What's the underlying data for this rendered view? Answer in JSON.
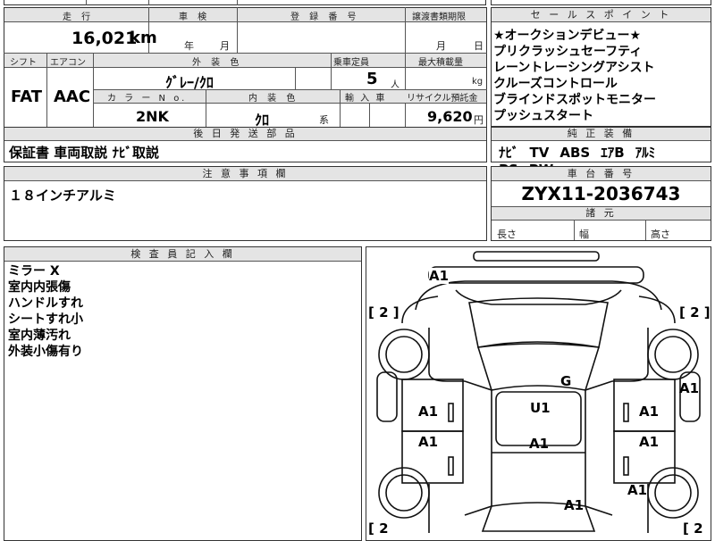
{
  "header": {
    "mileage_label": "走 行",
    "inspection_label": "車 検",
    "registration_label": "登 録 番 号",
    "transfer_deadline_label": "譲渡書類期限",
    "sales_points_label": "セ ー ル ス ポ イ ン ト",
    "shift_label": "シフト",
    "aircon_label": "エアコン",
    "exterior_color_label": "外 装 色",
    "capacity_label": "乗車定員",
    "max_load_label": "最大積載量",
    "color_no_label": "カ ラ ー N o.",
    "interior_color_label": "内 装 色",
    "import_label": "輸 入 車",
    "recycle_label": "リサイクル預託金",
    "parts_label": "後 日 発 送 部 品",
    "standard_equipment_label": "純 正 装 備",
    "notes_label": "注 意 事 項 欄",
    "chassis_label": "車 台 番 号",
    "dimensions_label": "諸 元",
    "inspector_label": "検 査 員 記 入 欄"
  },
  "vehicle": {
    "mileage": "16,021",
    "mileage_unit": "km",
    "inspection_year_unit": "年",
    "inspection_month_unit": "月",
    "deadline_month_unit": "月",
    "deadline_day_unit": "日",
    "shift": "FAT",
    "aircon": "AAC",
    "exterior_color": "ｸﾞﾚｰ/ｸﾛ",
    "capacity": "5",
    "capacity_unit": "人",
    "load_unit": "kg",
    "color_no": "2NK",
    "interior_color": "ｸﾛ",
    "interior_suffix": "系",
    "recycle_fee": "9,620",
    "recycle_unit": "円",
    "chassis_no": "ZYX11-2036743",
    "length_label": "長さ",
    "width_label": "幅",
    "height_label": "高さ"
  },
  "sales_points": [
    "★オークションデビュー★",
    "プリクラッシュセーフティ",
    "レーントレーシングアシスト",
    "クルーズコントロール",
    "ブラインドスポットモニター",
    "プッシュスタート"
  ],
  "equipment": [
    "ﾅﾋﾞ",
    "TV",
    "ABS",
    "ｴｱB",
    "ｱﾙﾐ",
    "PS",
    "PW"
  ],
  "parts_text": "保証書 車両取説 ﾅﾋﾞ取説",
  "notes_text": "１８インチアルミ",
  "inspector_notes": [
    "ミラー X",
    "室内内張傷",
    "ハンドルすれ",
    "シートすれ小",
    "室内薄汚れ",
    "外装小傷有り"
  ],
  "diagram": {
    "tire_marks": [
      "[ 2 ]",
      "[ 2 ]",
      "[ 2",
      "[ 2"
    ],
    "damage": {
      "front_bumper": "A1",
      "left_front_door": "A1",
      "right_front_door": "A1",
      "left_rear_door": "A1",
      "right_rear_door": "A1",
      "right_front_fender": "A1",
      "right_rear_fender": "A1",
      "windshield": "G",
      "roof": "U1",
      "roof_rear": "A1",
      "rear_glass": "A1"
    }
  }
}
